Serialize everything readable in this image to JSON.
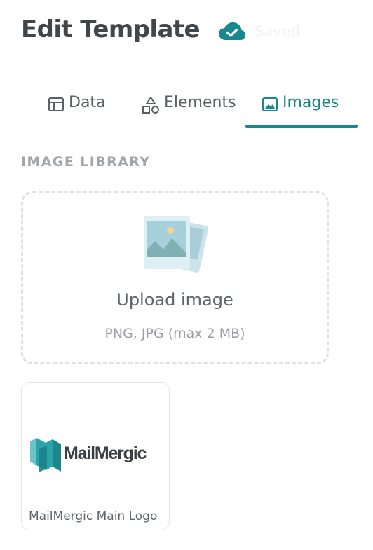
{
  "header": {
    "title": "Edit Template",
    "save_status": "Saved",
    "save_icon": "cloud-check-icon"
  },
  "tabs": [
    {
      "label": "Data",
      "icon": "table-icon",
      "active": false
    },
    {
      "label": "Elements",
      "icon": "shapes-icon",
      "active": false
    },
    {
      "label": "Images",
      "icon": "image-icon",
      "active": true
    }
  ],
  "library": {
    "section_label": "IMAGE LIBRARY",
    "upload": {
      "title": "Upload image",
      "hint": "PNG, JPG (max 2 MB)"
    },
    "images": [
      {
        "logo_text": "MailMergic",
        "caption": "MailMergic Main Logo"
      }
    ]
  },
  "colors": {
    "accent": "#16888e",
    "text_primary": "#41464b",
    "text_muted": "#9a9ea2"
  }
}
